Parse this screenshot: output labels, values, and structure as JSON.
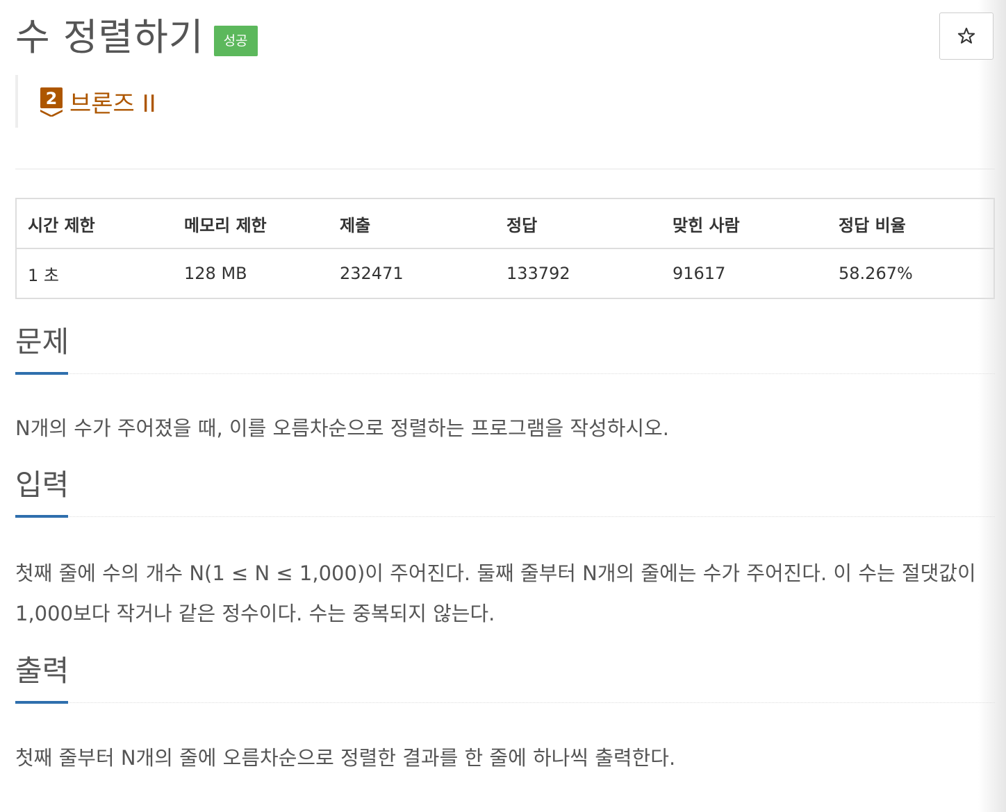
{
  "problem": {
    "title": "수 정렬하기",
    "status": "성공",
    "tier": {
      "level": "2",
      "label": "브론즈 II",
      "color": "#ad5600"
    },
    "favorite_icon": "star-icon"
  },
  "info_table": {
    "headers": [
      "시간 제한",
      "메모리 제한",
      "제출",
      "정답",
      "맞힌 사람",
      "정답 비율"
    ],
    "values": [
      "1 초",
      "128 MB",
      "232471",
      "133792",
      "91617",
      "58.267%"
    ]
  },
  "sections": {
    "problem": {
      "title": "문제",
      "body": "N개의 수가 주어졌을 때, 이를 오름차순으로 정렬하는 프로그램을 작성하시오."
    },
    "input": {
      "title": "입력",
      "body": "첫째 줄에 수의 개수 N(1 ≤ N ≤ 1,000)이 주어진다. 둘째 줄부터 N개의 줄에는 수가 주어진다. 이 수는 절댓값이 1,000보다 작거나 같은 정수이다. 수는 중복되지 않는다."
    },
    "output": {
      "title": "출력",
      "body": "첫째 줄부터 N개의 줄에 오름차순으로 정렬한 결과를 한 줄에 하나씩 출력한다."
    }
  },
  "colors": {
    "status_badge": "#5cb85c",
    "section_accent": "#2f6fad",
    "tier_bronze": "#ad5600"
  }
}
